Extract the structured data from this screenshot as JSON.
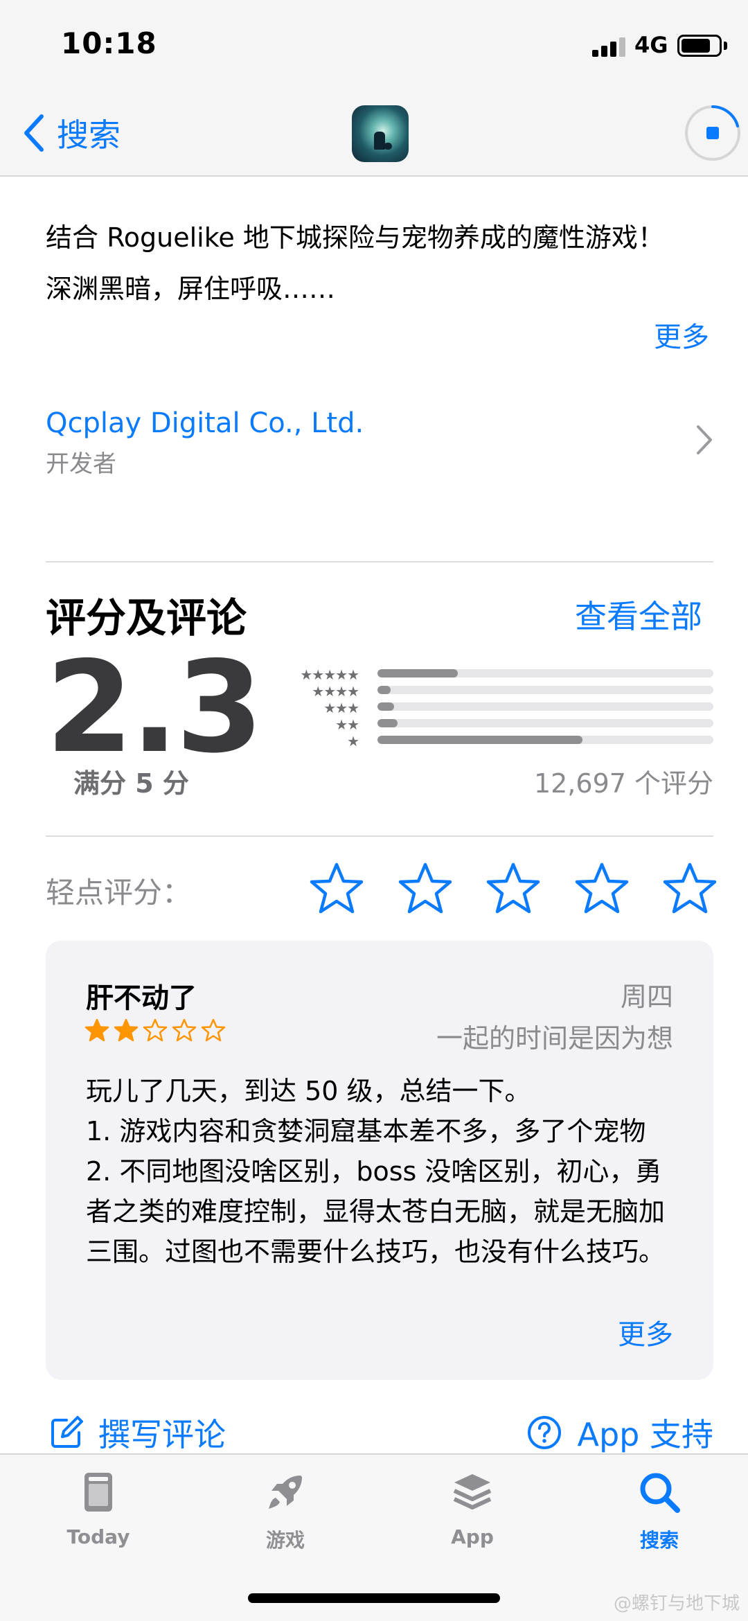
{
  "status": {
    "time": "10:18",
    "network": "4G"
  },
  "nav": {
    "back_label": "搜索"
  },
  "description": {
    "line1": "结合 Roguelike 地下城探险与宠物养成的魔性游戏！",
    "line2": "深渊黑暗，屏住呼吸……",
    "more": "更多"
  },
  "developer": {
    "name": "Qcplay Digital Co., Ltd.",
    "label": "开发者"
  },
  "ratings": {
    "title": "评分及评论",
    "see_all": "查看全部",
    "score": "2.3",
    "out_of": "满分 5 分",
    "count": "12,697 个评分",
    "distribution": [
      {
        "stars": "★★★★★",
        "fraction": 0.24
      },
      {
        "stars": "★★★★",
        "fraction": 0.04
      },
      {
        "stars": "★★★",
        "fraction": 0.05
      },
      {
        "stars": "★★",
        "fraction": 0.06
      },
      {
        "stars": "★",
        "fraction": 0.61
      }
    ]
  },
  "tap_to_rate": {
    "label": "轻点评分："
  },
  "review": {
    "title": "肝不动了",
    "date": "周四",
    "author": "一起的时间是因为想",
    "rating": 2,
    "body_lines": [
      "玩儿了几天，到达 50 级，总结一下。",
      "1. 游戏内容和贪婪洞窟基本差不多，多了个宠物",
      "2. 不同地图没啥区别，boss 没啥区别，初心，勇者之类的难度控制，显得太苍白无脑，就是无脑加三围。过图也不需要什么技巧，也没有什么技巧。"
    ],
    "more": "更多"
  },
  "actions": {
    "write_review": "撰写评论",
    "app_support": "App 支持"
  },
  "tabs": [
    {
      "label": "Today",
      "icon": "today-icon"
    },
    {
      "label": "游戏",
      "icon": "rocket-icon"
    },
    {
      "label": "App",
      "icon": "layers-icon"
    },
    {
      "label": "搜索",
      "icon": "search-icon"
    }
  ],
  "colors": {
    "accent": "#0a7aff",
    "star_orange": "#ff9500"
  },
  "watermark": "@螺钉与地下城"
}
